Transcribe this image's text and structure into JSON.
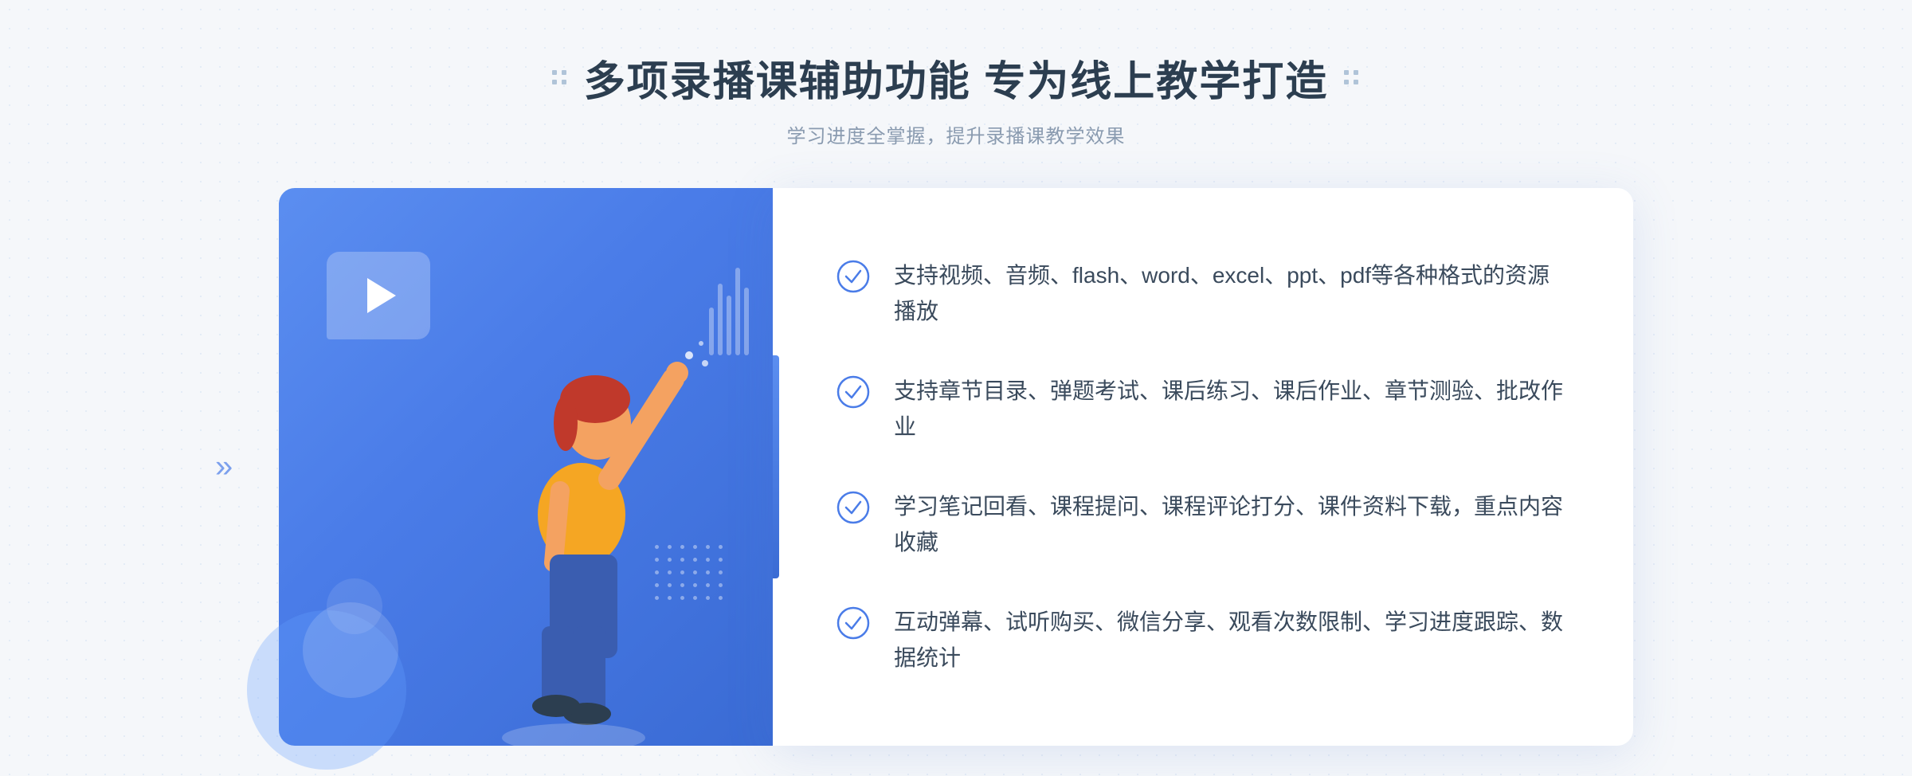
{
  "header": {
    "title": "多项录播课辅助功能 专为线上教学打造",
    "subtitle": "学习进度全掌握，提升录播课教学效果"
  },
  "features": [
    {
      "id": "feature-1",
      "text": "支持视频、音频、flash、word、excel、ppt、pdf等各种格式的资源播放"
    },
    {
      "id": "feature-2",
      "text": "支持章节目录、弹题考试、课后练习、课后作业、章节测验、批改作业"
    },
    {
      "id": "feature-3",
      "text": "学习笔记回看、课程提问、课程评论打分、课件资料下载，重点内容收藏"
    },
    {
      "id": "feature-4",
      "text": "互动弹幕、试听购买、微信分享、观看次数限制、学习进度跟踪、数据统计"
    }
  ],
  "colors": {
    "primary": "#4a7ce8",
    "primary_dark": "#3a6bd4",
    "text_dark": "#2c3e50",
    "text_gray": "#8a9bb0",
    "check_color": "#4a7ce8"
  }
}
